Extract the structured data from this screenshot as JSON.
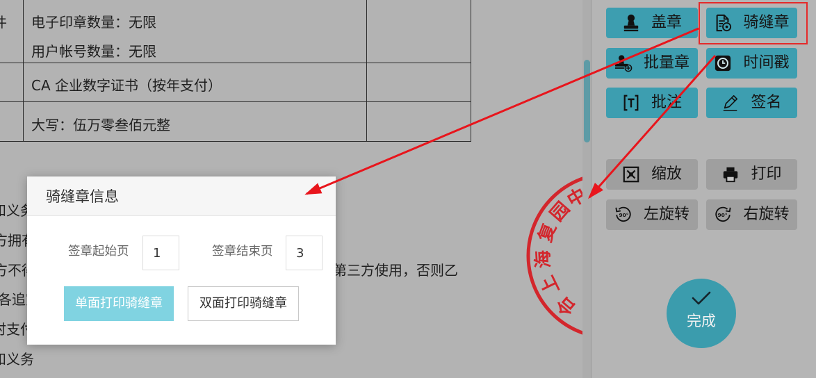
{
  "colors": {
    "dimmed_background": "#b3b3b3",
    "primary_button": "#3d9eb0",
    "secondary_button": "#9f9f9f",
    "done_button": "#3b9cad",
    "dialog_primary_button": "#80d3e1",
    "seal_red": "#d3262c",
    "annotation_red": "#e8151c",
    "scroll_thumb": "#5d9ba6"
  },
  "document": {
    "table": {
      "row1_left_fragment": "件",
      "row1_lines": [
        "电子印章数量：无限",
        "用户帐号数量：无限"
      ],
      "row2_text": "CA 企业数字证书（按年支付）",
      "row3_text": "大写：伍万零叁佰元整"
    },
    "text_fragments_left": [
      "和义务",
      "方拥有",
      "方不得",
      "各追究",
      "时支付",
      "和义务"
    ],
    "text_fragment_right": "第三方使用，否则乙"
  },
  "seal": {
    "visible_characters": [
      "合",
      "上",
      "海",
      "复",
      "园",
      "中"
    ]
  },
  "dialog": {
    "title": "骑缝章信息",
    "start_label": "签章起始页",
    "start_value": "1",
    "end_label": "签章结束页",
    "end_value": "3",
    "single_side_button": "单面打印骑缝章",
    "double_side_button": "双面打印骑缝章"
  },
  "toolbar": {
    "buttons": [
      {
        "label": "盖章",
        "icon": "stamp-icon"
      },
      {
        "label": "骑缝章",
        "icon": "paging-seal-icon",
        "highlighted": true
      },
      {
        "label": "批量章",
        "icon": "batch-stamp-icon"
      },
      {
        "label": "时间戳",
        "icon": "timestamp-icon"
      },
      {
        "label": "批注",
        "icon": "annotation-icon"
      },
      {
        "label": "签名",
        "icon": "signature-icon"
      },
      {
        "label": "缩放",
        "icon": "zoom-icon"
      },
      {
        "label": "打印",
        "icon": "print-icon"
      },
      {
        "label": "左旋转",
        "icon": "rotate-left-icon",
        "icon_text": "90°"
      },
      {
        "label": "右旋转",
        "icon": "rotate-right-icon",
        "icon_text": "90°"
      }
    ],
    "done": {
      "label": "完成",
      "icon": "check-icon"
    }
  }
}
